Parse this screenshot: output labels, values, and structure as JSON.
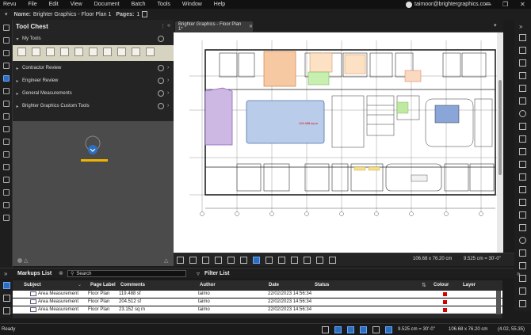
{
  "app": {
    "name": "Revu"
  },
  "menu": [
    "Revu",
    "File",
    "Edit",
    "View",
    "Document",
    "Batch",
    "Tools",
    "Window",
    "Help"
  ],
  "user": {
    "email": "taimoor@brightergraphics.com"
  },
  "namebar": {
    "name_label": "Name:",
    "name_value": "Brighter Graphics - Floor Plan 1",
    "pages_label": "Pages:",
    "pages_value": "1"
  },
  "toolchest": {
    "title": "Tool Chest",
    "my_tools": "My Tools",
    "sections": [
      "Contractor Review",
      "Engineer Review",
      "General Measurements",
      "Brighter Graphics Custom Tools"
    ]
  },
  "document_tab": {
    "label": "Brighter Graphics - Floor Plan 1*"
  },
  "plan": {
    "highlight_area": "119.488 sq.m"
  },
  "viewer_toolbar": {
    "page_size": "106.68 x 76.20 cm",
    "scale": "9.525 cm = 30'-0\""
  },
  "markups": {
    "title": "Markups List",
    "search_placeholder": "Search",
    "filter_label": "Filter List",
    "columns": [
      "Subject",
      "Page Label",
      "Comments",
      "Author",
      "Date",
      "Status",
      "Colour",
      "Layer"
    ],
    "rows": [
      {
        "subject": "Area Measurement",
        "page": "Floor Plan",
        "comment": "119.488 sf",
        "author": "taimo",
        "date": "22/02/2023 14:56:34",
        "colour": "#d40000"
      },
      {
        "subject": "Area Measurement",
        "page": "Floor Plan",
        "comment": "204.512 sf",
        "author": "taimo",
        "date": "22/02/2023 14:56:34",
        "colour": "#d40000"
      },
      {
        "subject": "Area Measurement",
        "page": "Floor Plan",
        "comment": "23.152 sq m",
        "author": "taimo",
        "date": "22/02/2023 14:56:34",
        "colour": "#d40000"
      }
    ]
  },
  "statusbar": {
    "ready": "Ready",
    "scale": "9.525 cm = 30'-0\"",
    "page_size": "106.68 x 76.20 cm",
    "coords": "(4.02, 55.35)"
  },
  "colors": {
    "accent": "#2c6fbf",
    "markup_red": "#d40000"
  }
}
